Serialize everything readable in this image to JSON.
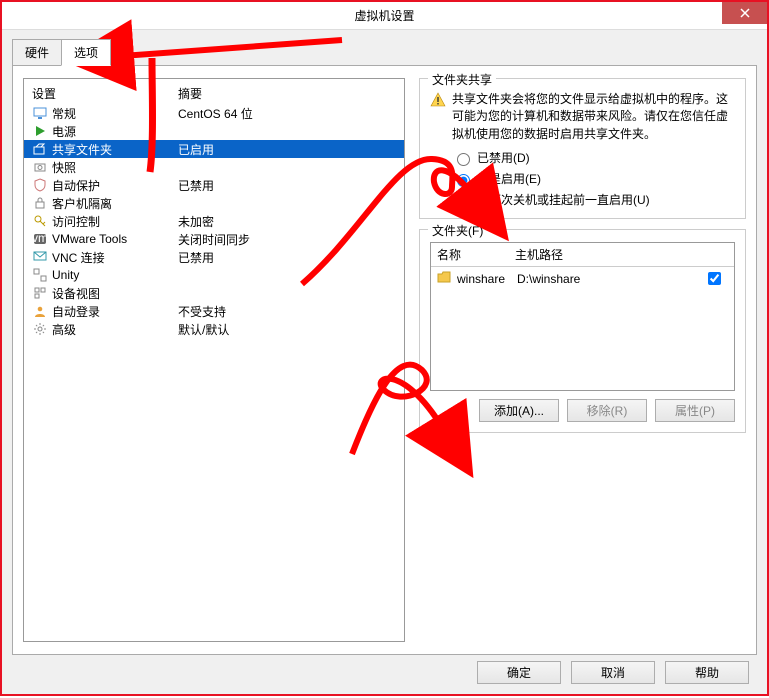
{
  "window": {
    "title": "虚拟机设置"
  },
  "tabs": {
    "hardware": "硬件",
    "options": "选项"
  },
  "columns": {
    "setting": "设置",
    "summary": "摘要"
  },
  "rows": [
    {
      "name": "常规",
      "summary": "CentOS 64 位",
      "icon": "monitor"
    },
    {
      "name": "电源",
      "summary": "",
      "icon": "play"
    },
    {
      "name": "共享文件夹",
      "summary": "已启用",
      "icon": "share",
      "selected": true
    },
    {
      "name": "快照",
      "summary": "",
      "icon": "snapshot"
    },
    {
      "name": "自动保护",
      "summary": "已禁用",
      "icon": "shield"
    },
    {
      "name": "客户机隔离",
      "summary": "",
      "icon": "lock"
    },
    {
      "name": "访问控制",
      "summary": "未加密",
      "icon": "key"
    },
    {
      "name": "VMware Tools",
      "summary": "关闭时间同步",
      "icon": "vm"
    },
    {
      "name": "VNC 连接",
      "summary": "已禁用",
      "icon": "vnc"
    },
    {
      "name": "Unity",
      "summary": "",
      "icon": "unity"
    },
    {
      "name": "设备视图",
      "summary": "",
      "icon": "device"
    },
    {
      "name": "自动登录",
      "summary": "不受支持",
      "icon": "user"
    },
    {
      "name": "高级",
      "summary": "默认/默认",
      "icon": "gear"
    }
  ],
  "share": {
    "group_title": "文件夹共享",
    "warning": "共享文件夹会将您的文件显示给虚拟机中的程序。这可能为您的计算机和数据带来风险。请仅在您信任虚拟机使用您的数据时启用共享文件夹。",
    "radio_disabled": "已禁用(D)",
    "radio_always": "总是启用(E)",
    "radio_until": "在下次关机或挂起前一直启用(U)",
    "selected_radio": "always"
  },
  "folders": {
    "group_title": "文件夹(F)",
    "col_name": "名称",
    "col_path": "主机路径",
    "items": [
      {
        "name": "winshare",
        "path": "D:\\winshare",
        "checked": true
      }
    ],
    "add": "添加(A)...",
    "remove": "移除(R)",
    "props": "属性(P)"
  },
  "buttons": {
    "ok": "确定",
    "cancel": "取消",
    "help": "帮助"
  }
}
